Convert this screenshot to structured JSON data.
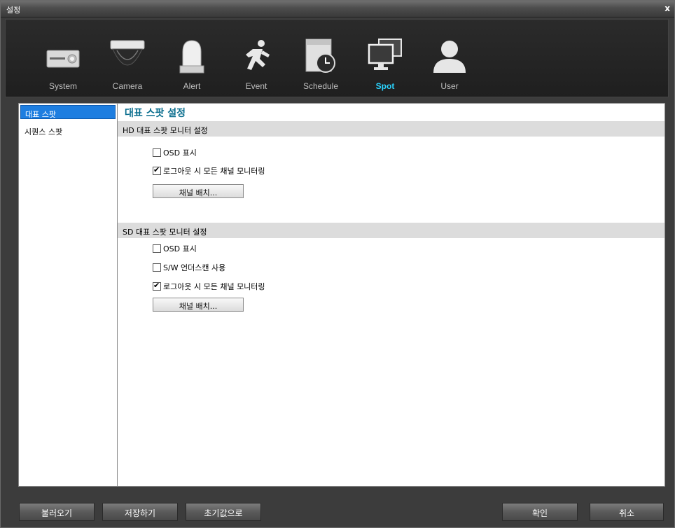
{
  "window": {
    "title": "설정",
    "close": "x"
  },
  "toolbar": {
    "items": [
      {
        "label": "System",
        "icon": "dvr-icon"
      },
      {
        "label": "Camera",
        "icon": "dome-camera-icon"
      },
      {
        "label": "Alert",
        "icon": "alarm-light-icon"
      },
      {
        "label": "Event",
        "icon": "running-person-icon"
      },
      {
        "label": "Schedule",
        "icon": "clock-icon"
      },
      {
        "label": "Spot",
        "icon": "monitor-icon"
      },
      {
        "label": "User",
        "icon": "user-icon"
      }
    ],
    "active": "Spot",
    "active_color": "#2ad4ff"
  },
  "sidebar": {
    "items": [
      {
        "label": "대표 스팟"
      },
      {
        "label": "시퀀스 스팟"
      }
    ],
    "selected": "대표 스팟",
    "selected_color": "#1e7ee0"
  },
  "main": {
    "title": "대표 스팟 설정",
    "hd": {
      "header": "HD 대표 스팟 모니터 설정",
      "osd": {
        "label": "OSD 표시",
        "checked": false
      },
      "logout": {
        "label": "로그아웃 시 모든 채널 모니터링",
        "checked": true
      },
      "layout_button": "채널 배치..."
    },
    "sd": {
      "header": "SD 대표 스팟 모니터 설정",
      "osd": {
        "label": "OSD 표시",
        "checked": false
      },
      "underscan": {
        "label": "S/W 언더스캔 사용",
        "checked": false
      },
      "logout": {
        "label": "로그아웃 시 모든 채널 모니터링",
        "checked": true
      },
      "layout_button": "채널 배치..."
    }
  },
  "footer": {
    "load": "불러오기",
    "save": "저장하기",
    "reset": "초기값으로",
    "ok": "확인",
    "cancel": "취소"
  }
}
